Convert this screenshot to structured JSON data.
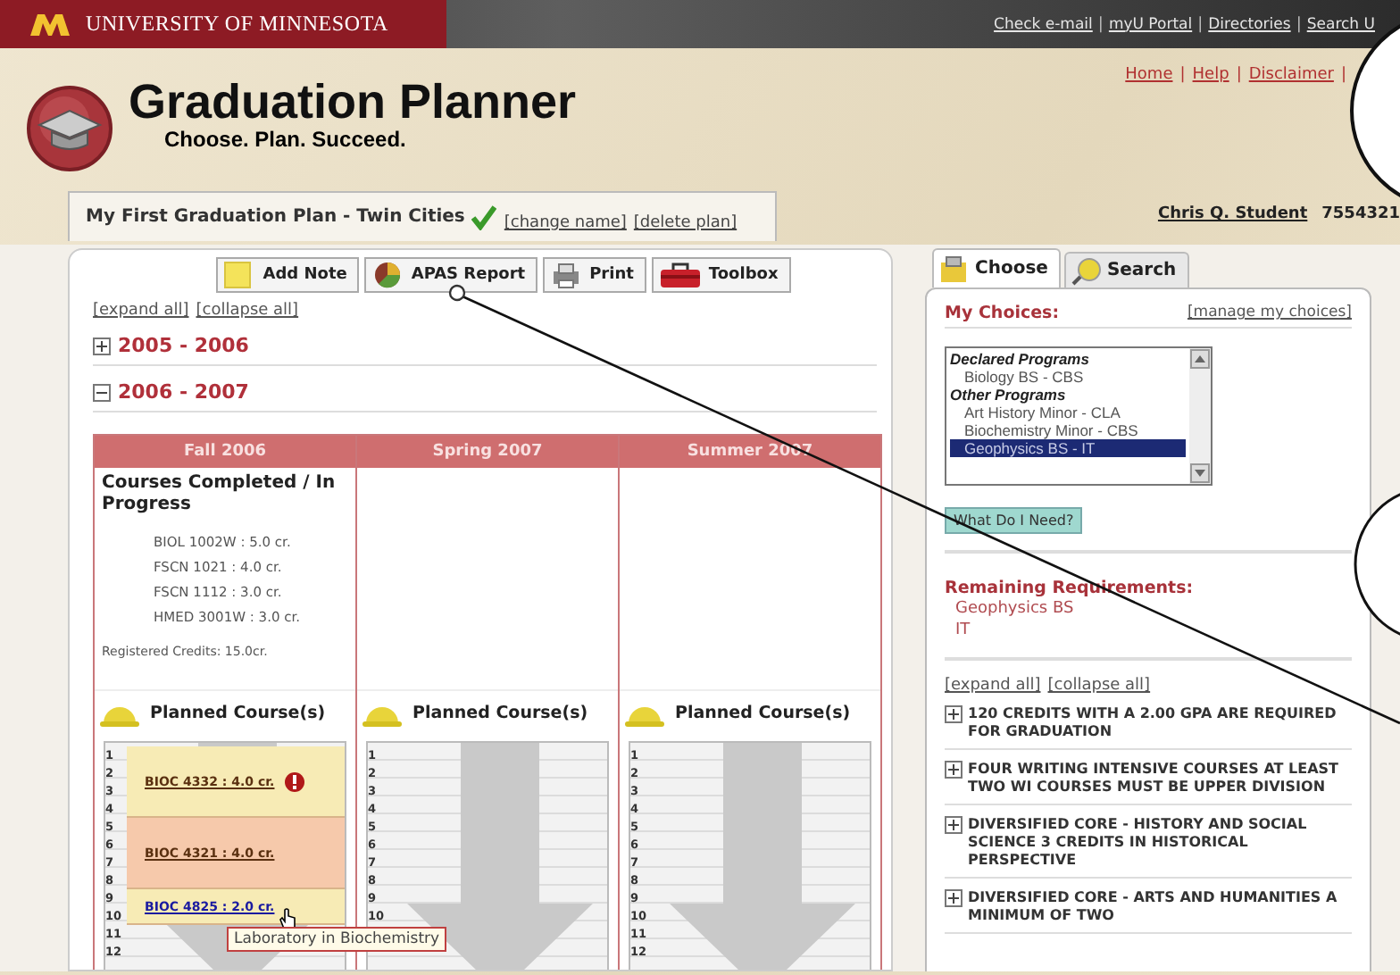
{
  "top_bar": {
    "brand": "UNIVERSITY OF MINNESOTA",
    "links": [
      "Check e-mail",
      "myU Portal",
      "Directories",
      "Search U"
    ],
    "separators": [
      "|",
      "|",
      "|"
    ]
  },
  "header": {
    "title": "Graduation Planner",
    "tagline": "Choose. Plan. Succeed.",
    "links": [
      "Home",
      "Help",
      "Disclaimer"
    ],
    "separators": [
      "|",
      "|",
      "|"
    ]
  },
  "plan": {
    "name": "My First Graduation Plan - Twin Cities",
    "actions": [
      "[change name]",
      "[delete plan]"
    ]
  },
  "user": {
    "name": "Chris Q. Student",
    "id": "7554321"
  },
  "toolbar": [
    {
      "label": "Add Note",
      "kind": "note"
    },
    {
      "label": "APAS Report",
      "kind": "report"
    },
    {
      "label": "Print",
      "kind": "print"
    },
    {
      "label": "Toolbox",
      "kind": "toolbox"
    }
  ],
  "outline_links": [
    "[expand all]",
    "[collapse all]"
  ],
  "years": [
    {
      "label": "2005 - 2006",
      "expanded": false
    },
    {
      "label": "2006 - 2007",
      "expanded": true
    }
  ],
  "terms": [
    {
      "name": "Fall 2006",
      "completed": {
        "title": "Courses Completed / In Progress",
        "courses": [
          "BIOL 1002W : 5.0 cr.",
          "FSCN 1021 : 4.0 cr.",
          "FSCN 1112 : 3.0 cr.",
          "HMED 3001W : 3.0 cr."
        ],
        "registered": "Registered Credits: 15.0cr."
      },
      "planned_title": "Planned Course(s)",
      "slots": [
        "1",
        "2",
        "3",
        "4",
        "5",
        "6",
        "7",
        "8",
        "9",
        "10",
        "11",
        "12"
      ],
      "courses": [
        {
          "label": "BIOC 4332 : 4.0 cr.",
          "kind": "tall",
          "color": "#f7ebb5",
          "warning": true,
          "hovered": false
        },
        {
          "label": "BIOC 4321 : 4.0 cr.",
          "kind": "tall",
          "color": "#f6c9ab",
          "warning": false,
          "hovered": false
        },
        {
          "label": "BIOC 4825 : 2.0 cr.",
          "kind": "short",
          "color": "#f7ebb5",
          "warning": false,
          "hovered": true
        }
      ],
      "tooltip": "Laboratory in Biochemistry"
    },
    {
      "name": "Spring 2007",
      "planned_title": "Planned Course(s)",
      "slots": [
        "1",
        "2",
        "3",
        "4",
        "5",
        "6",
        "7",
        "8",
        "9",
        "10"
      ]
    },
    {
      "name": "Summer 2007",
      "planned_title": "Planned Course(s)",
      "slots": [
        "1",
        "2",
        "3",
        "4",
        "5",
        "6",
        "7",
        "8",
        "9",
        "10",
        "11",
        "12"
      ]
    }
  ],
  "side_tabs": [
    {
      "label": "Choose",
      "kind": "choose",
      "selected": true
    },
    {
      "label": "Search",
      "kind": "search",
      "selected": false
    }
  ],
  "my_choices": {
    "title": "My Choices:",
    "link": "[manage my choices]",
    "options": [
      {
        "text": "Declared Programs",
        "kind": "group"
      },
      {
        "text": "Biology BS - CBS",
        "kind": "item",
        "selected": false
      },
      {
        "text": "Other Programs",
        "kind": "group"
      },
      {
        "text": "Art History Minor - CLA",
        "kind": "item",
        "selected": false
      },
      {
        "text": "Biochemistry Minor - CBS",
        "kind": "item",
        "selected": false
      },
      {
        "text": "Geophysics BS - IT",
        "kind": "item",
        "selected": true
      }
    ],
    "button": "What Do I Need?"
  },
  "remaining": {
    "title": "Remaining Requirements:",
    "lines": [
      "Geophysics BS",
      "IT"
    ]
  },
  "requirement_links": [
    "[expand all]",
    "[collapse all]"
  ],
  "requirements": [
    {
      "text": "120 CREDITS WITH A 2.00 GPA ARE REQUIRED FOR GRADUATION",
      "expanded": false
    },
    {
      "text": "FOUR WRITING INTENSIVE COURSES AT LEAST TWO WI COURSES MUST BE UPPER DIVISION",
      "expanded": false
    },
    {
      "text": "DIVERSIFIED CORE - HISTORY AND SOCIAL SCIENCE 3 CREDITS IN HISTORICAL PERSPECTIVE",
      "expanded": false
    },
    {
      "text": "DIVERSIFIED CORE - ARTS AND HUMANITIES  A MINIMUM OF TWO",
      "expanded": false
    }
  ]
}
